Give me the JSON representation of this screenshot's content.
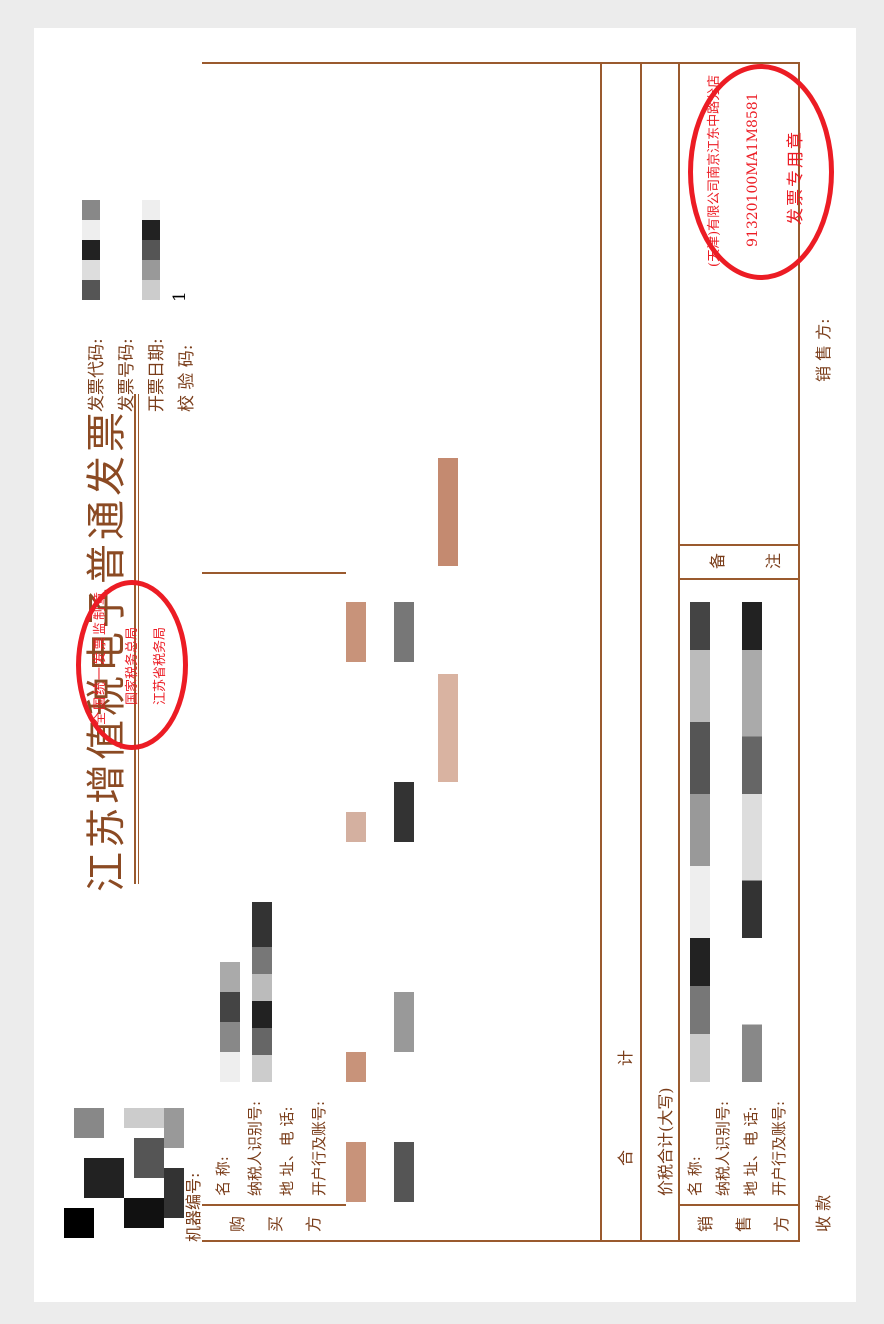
{
  "invoice": {
    "title": "江苏增值税电子普通发票",
    "meta": {
      "code_label": "发票代码:",
      "number_label": "发票号码:",
      "date_label": "开票日期:",
      "check_label": "校 验 码:",
      "check_partial": "1"
    },
    "machine_label": "机器编号:",
    "buyer": {
      "side_label": [
        "购",
        "买",
        "方"
      ],
      "name_label": "名        称:",
      "tax_id_label": "纳税人识别号:",
      "address_label": "地 址、电 话:",
      "bank_label": "开户行及账号:"
    },
    "total_label": [
      "合",
      "计"
    ],
    "total_words_label": "价税合计(大写)",
    "seller": {
      "side_label": [
        "销",
        "售",
        "方"
      ],
      "name_label": "名        称:",
      "tax_id_label": "纳税人识别号:",
      "address_label": "地 址、电 话:",
      "bank_label": "开户行及账号:"
    },
    "remarks_label": [
      "备",
      "注"
    ],
    "payee_label": "收 款",
    "seller_footer_label": "销 售 方:"
  },
  "stamps": {
    "tax_bureau": {
      "top_text": "全国统一发票监制章",
      "middle_text": "国家税务总局",
      "bottom_text": "江苏省税务局"
    },
    "seller_seal": {
      "company_text": "(天津)有限公司南京江东中路分店",
      "id_text": "91320100MA1M8581",
      "bottom_text": "发票专用章"
    }
  },
  "colors": {
    "frame": "#9a5a2e",
    "stamp": "#ec1c24",
    "paper": "#ffffff",
    "background": "#ececec"
  }
}
